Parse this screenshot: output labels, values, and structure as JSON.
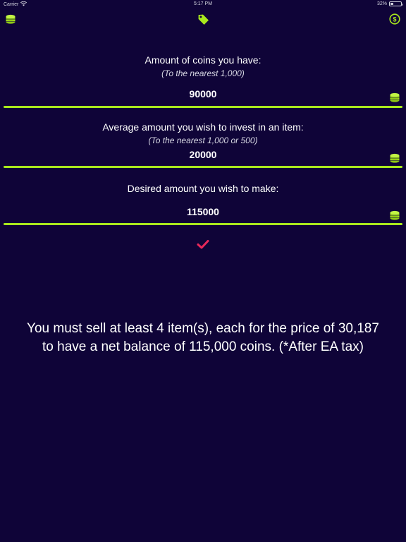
{
  "status_bar": {
    "carrier": "Carrier",
    "time": "5:17 PM",
    "battery": "32%",
    "battery_level": 0.32
  },
  "nav": {
    "left_icon": "coin-stack-icon",
    "center_icon": "price-tag-icon",
    "right_icon": "coin-dollar-icon"
  },
  "fields": [
    {
      "label": "Amount of coins you have:",
      "hint": "(To the nearest 1,000)",
      "value": "90000"
    },
    {
      "label": "Average amount you wish to invest in an item:",
      "hint": "(To the nearest 1,000 or 500)",
      "value": "20000"
    },
    {
      "label": "Desired amount you wish to make:",
      "hint": "",
      "value": "115000"
    }
  ],
  "submit_icon": "checkmark-icon",
  "result": {
    "line1": "You must sell at least 4 item(s), each for the price of 30,187",
    "line2": "to have a net balance of 115,000 coins. (*After EA tax)"
  },
  "colors": {
    "background": "#0f0438",
    "accent_green": "#a9e81d",
    "check_pink": "#e8285a"
  }
}
